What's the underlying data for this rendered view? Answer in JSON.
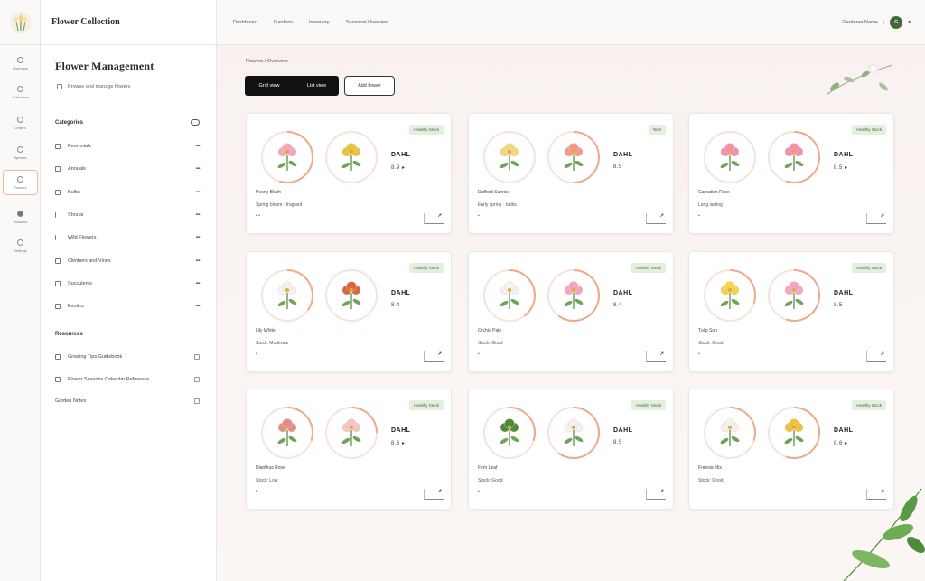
{
  "app": {
    "brand": "Flower Collection",
    "page_title": "Flower Management",
    "page_subtitle": "Browse and manage flowers"
  },
  "rail": {
    "items": [
      {
        "label": "Overview"
      },
      {
        "label": "Collections"
      },
      {
        "label": "Orders"
      },
      {
        "label": "Species"
      },
      {
        "label": "Flowers"
      },
      {
        "label": "Seasons"
      },
      {
        "label": "Settings"
      }
    ]
  },
  "sidebar": {
    "section1": "Categories",
    "items": [
      {
        "label": "Perennials",
        "count": "•••"
      },
      {
        "label": "Annuals",
        "count": "•••"
      },
      {
        "label": "Bulbs",
        "count": "•••"
      },
      {
        "label": "Shrubs",
        "count": "•••"
      },
      {
        "label": "Wild Flowers",
        "count": "•••"
      },
      {
        "label": "Climbers and Vines",
        "count": "•••"
      },
      {
        "label": "Succulents",
        "count": "•••"
      },
      {
        "label": "Exotics",
        "count": "•••"
      }
    ],
    "section2": "Resources",
    "resources": [
      {
        "label": "Growing Tips Guidebook"
      },
      {
        "label": "Flower Seasons Calendar Reference"
      },
      {
        "label": "Garden Notes"
      }
    ]
  },
  "topbar": {
    "links": [
      "Dashboard",
      "Gardens",
      "Inventory",
      "Seasonal Overview"
    ],
    "user_label": "Gardener Name",
    "avatar_initials": "G"
  },
  "main": {
    "breadcrumb": "Flowers / Overview",
    "buttons": {
      "tab1": "Grid view",
      "tab2": "List view",
      "new": "Add flower"
    }
  },
  "cards": [
    {
      "tag": "Healthy Stock",
      "metric": "DAHL",
      "metric2": "8.9 ▸",
      "name": "Peony Blush",
      "desc": "Spring bloom · fragrant",
      "dot": "• •",
      "action": "↗"
    },
    {
      "tag": "New",
      "metric": "DAHL",
      "metric2": "8.5",
      "name": "Daffodil Sunrise",
      "desc": "Early spring · bulbs",
      "dot": "•",
      "action": "↗"
    },
    {
      "tag": "Healthy Stock",
      "metric": "DAHL",
      "metric2": "8.5 ▸",
      "name": "Carnation Rose",
      "desc": "Long lasting",
      "dot": "•",
      "action": "↗"
    },
    {
      "tag": "Healthy Stock",
      "metric": "DAHL",
      "metric2": "8.4",
      "name": "Lily White",
      "desc": "Stock: Moderate",
      "dot": "•",
      "action": "↗"
    },
    {
      "tag": "Healthy Stock",
      "metric": "DAHL",
      "metric2": "8.4",
      "name": "Orchid Pale",
      "desc": "Stock: Good",
      "dot": "•",
      "action": "↗"
    },
    {
      "tag": "Healthy Stock",
      "metric": "DAHL",
      "metric2": "8.5",
      "name": "Tulip Sun",
      "desc": "Stock: Good",
      "dot": "•",
      "action": "↗"
    },
    {
      "tag": "Healthy Stock",
      "metric": "DAHL",
      "metric2": "8.6 ▸",
      "name": "Dianthus Rose",
      "desc": "Stock: Low",
      "dot": "•",
      "action": "↗"
    },
    {
      "tag": "Healthy Stock",
      "metric": "DAHL",
      "metric2": "8.5",
      "name": "Fern Leaf",
      "desc": "Stock: Good",
      "dot": "•",
      "action": "↗"
    },
    {
      "tag": "Healthy Stock",
      "metric": "DAHL",
      "metric2": "8.6 ▸",
      "name": "Freesia Mix",
      "desc": "Stock: Good",
      "dot": "",
      "action": "↗"
    }
  ]
}
